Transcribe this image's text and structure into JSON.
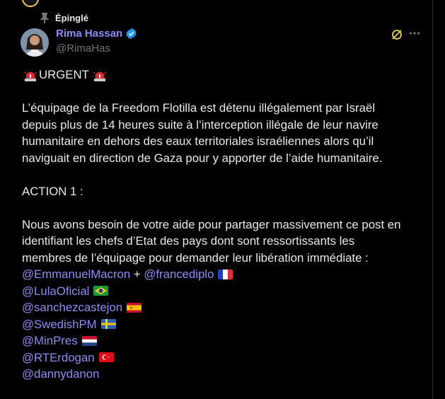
{
  "post": {
    "pinned_label": "Épinglé",
    "author": {
      "display_name": "Rima Hassan",
      "handle": "@RimaHas",
      "verified": true
    },
    "accent_color": "#8e8cf5",
    "title": "URGENT",
    "paragraph1": [
      "L’équipage de la Freedom Flotilla est détenu illégalement par Israël",
      "depuis plus de 14 heures suite à l’interception illégale de leur navire",
      "humanitaire en dehors des eaux territoriales israéliennes alors qu’il",
      "naviguait en direction de Gaza pour y apporter de l’aide humanitaire."
    ],
    "action_heading": "ACTION 1 :",
    "paragraph2": [
      "Nous avons besoin de votre aide pour partager massivement ce post en",
      "identifiant les chefs d’Etat des pays dont sont ressortissants les",
      "membres de l’équipage pour demander leur libération immédiate :"
    ],
    "mentions": {
      "row1_a": "@EmmanuelMacron",
      "row1_plus": " + ",
      "row1_b": "@francediplo",
      "lula": "@LulaOficial",
      "sanchez": "@sanchezcastejon",
      "swedish": "@SwedishPM",
      "minpres": "@MinPres",
      "erdogan": "@RTErdogan",
      "danon": "@dannydanon"
    }
  }
}
